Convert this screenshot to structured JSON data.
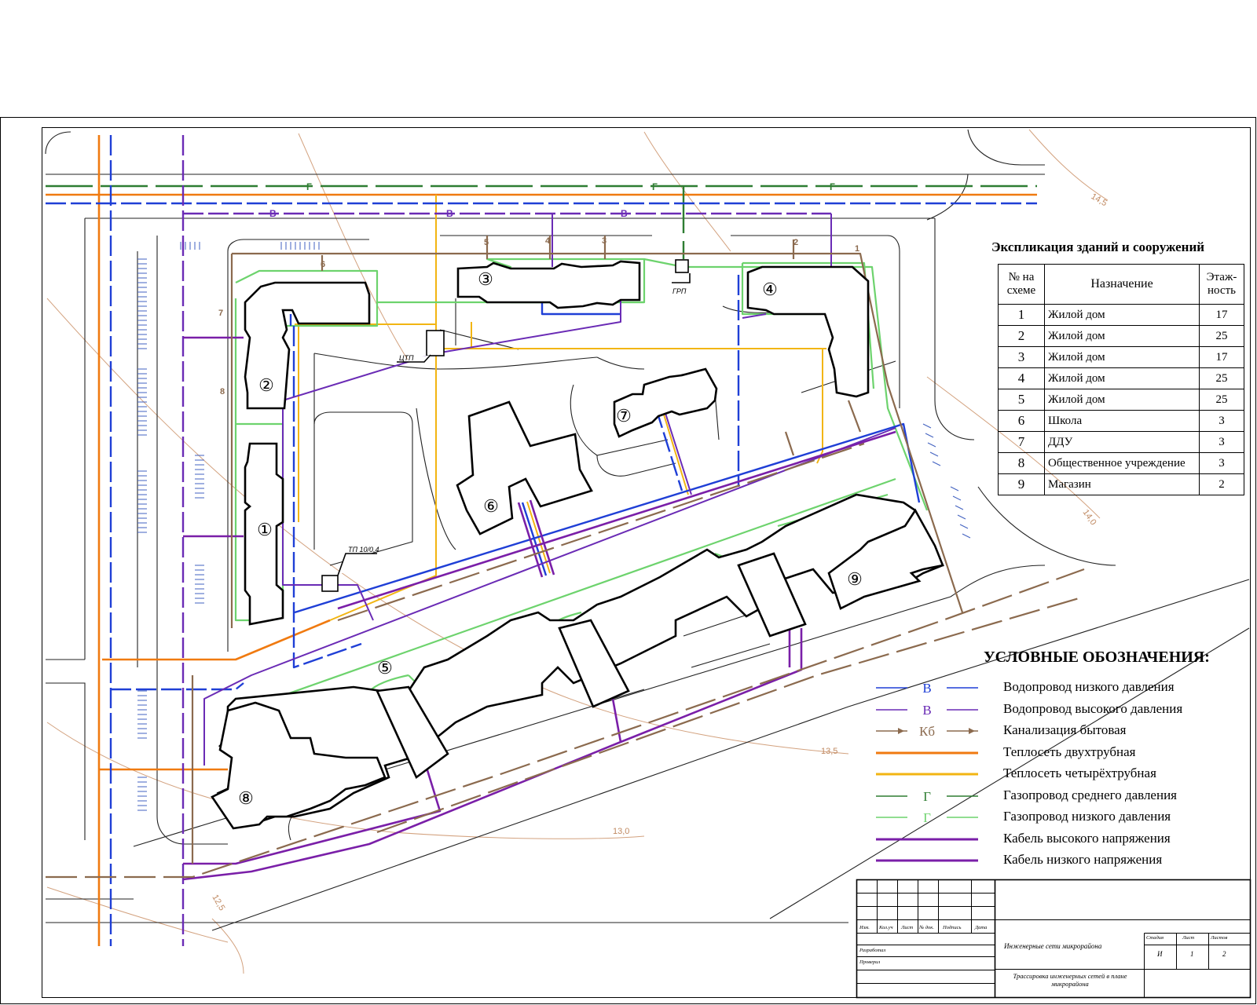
{
  "explication": {
    "title": "Экспликация зданий и сооружений",
    "headers": {
      "num": "№ на схеме",
      "purpose": "Назначение",
      "floors": "Этаж-ность"
    },
    "rows": [
      {
        "num": "1",
        "purpose": "Жилой дом",
        "floors": "17"
      },
      {
        "num": "2",
        "purpose": "Жилой дом",
        "floors": "25"
      },
      {
        "num": "3",
        "purpose": "Жилой дом",
        "floors": "17"
      },
      {
        "num": "4",
        "purpose": "Жилой дом",
        "floors": "25"
      },
      {
        "num": "5",
        "purpose": "Жилой дом",
        "floors": "25"
      },
      {
        "num": "6",
        "purpose": "Школа",
        "floors": "3"
      },
      {
        "num": "7",
        "purpose": "ДДУ",
        "floors": "3"
      },
      {
        "num": "8",
        "purpose": "Общественное учреждение",
        "floors": "3"
      },
      {
        "num": "9",
        "purpose": "Магазин",
        "floors": "2"
      }
    ]
  },
  "legend": {
    "title": "УСЛОВНЫЕ ОБОЗНАЧЕНИЯ:",
    "items": [
      {
        "label": "Водопровод низкого давления",
        "symbol": "В",
        "color": "#1f3fd6"
      },
      {
        "label": "Водопровод высокого давления",
        "symbol": "В",
        "color": "#6a2bb5"
      },
      {
        "label": "Канализация бытовая",
        "symbol": "Кб",
        "color": "#8b6a4e"
      },
      {
        "label": "Теплосеть двухтрубная",
        "symbol": "",
        "color": "#f07a10"
      },
      {
        "label": "Теплосеть четырёхтрубная",
        "symbol": "",
        "color": "#f2b512"
      },
      {
        "label": "Газопровод среднего давления",
        "symbol": "Г",
        "color": "#2e7d32"
      },
      {
        "label": "Газопровод низкого давления",
        "symbol": "Г",
        "color": "#6dd36d"
      },
      {
        "label": "Кабель высокого напряжения",
        "symbol": "",
        "color": "#7a1fa8"
      },
      {
        "label": "Кабель низкого напряжения",
        "symbol": "",
        "color": "#7a1fa8"
      }
    ]
  },
  "plan": {
    "building_labels": [
      "①",
      "②",
      "③",
      "④",
      "⑤",
      "⑥",
      "⑦",
      "⑧",
      "⑨"
    ],
    "facility_labels": {
      "heating_point": "ЦТП",
      "gas_point": "ГРП",
      "transformer": "ТП 10/0,4"
    },
    "contour_labels": [
      "14,5",
      "14,0",
      "13,5",
      "13,0",
      "12,5"
    ],
    "sewer_well_numbers": [
      "1",
      "2",
      "3",
      "4",
      "5",
      "6",
      "7",
      "8"
    ]
  },
  "title_block": {
    "project": "Инженерные сети микрорайона",
    "sheet_title": "Трассировка инженерных сетей в плане микрорайона",
    "stage_label": "Стадия",
    "sheet_label": "Лист",
    "sheets_label": "Листов",
    "stage": "И",
    "sheet": "1",
    "sheets": "2",
    "row_labels": [
      "Изм.",
      "Кол.уч",
      "Лист",
      "№ док.",
      "Подпись",
      "Дата"
    ],
    "dev_label": "Разработал",
    "check_label": "Проверил"
  },
  "colors": {
    "water_low": "#1f3fd6",
    "water_high": "#6a2bb5",
    "sewer": "#8b6a4e",
    "heat2": "#f07a10",
    "heat4": "#f2b512",
    "gas_mid": "#2e7d32",
    "gas_low": "#6dd36d",
    "cable": "#7a1fa8",
    "contour": "#d3a27f"
  }
}
